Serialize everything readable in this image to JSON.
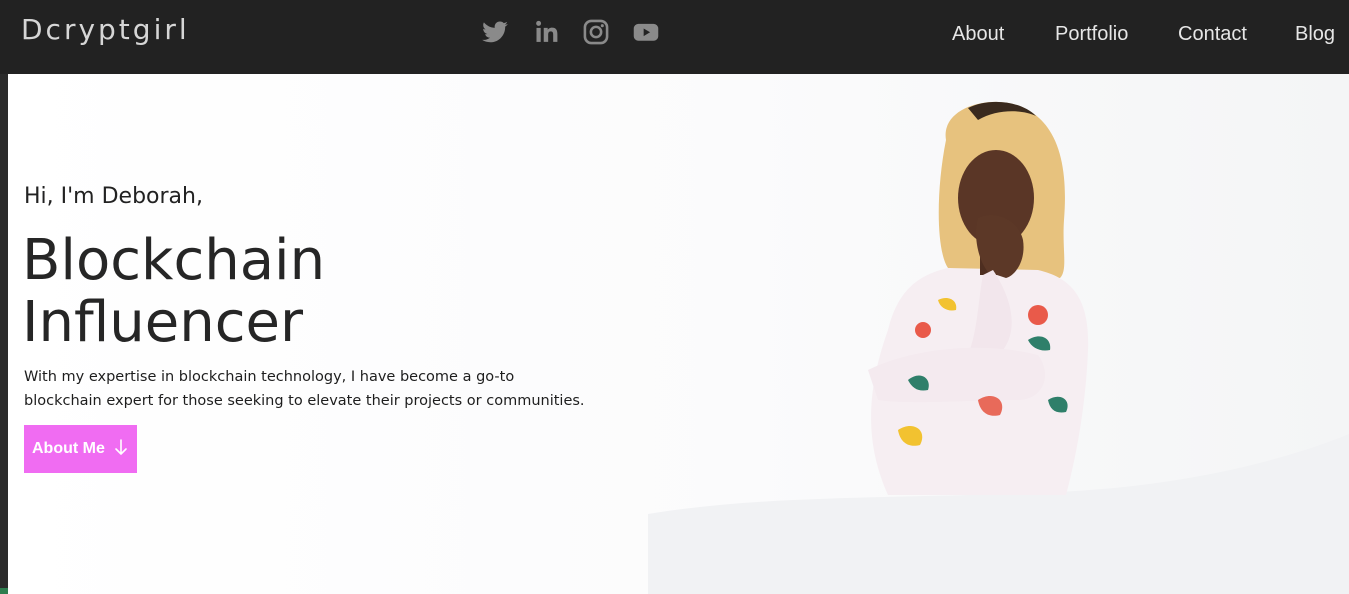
{
  "brand": "Dcryptgirl",
  "socials": [
    {
      "icon": "twitter-icon"
    },
    {
      "icon": "linkedin-icon"
    },
    {
      "icon": "instagram-icon"
    },
    {
      "icon": "youtube-icon"
    }
  ],
  "nav": {
    "about": "About",
    "portfolio": "Portfolio",
    "contact": "Contact",
    "blog": "Blog"
  },
  "hero": {
    "greeting": "Hi, I'm Deborah,",
    "headline_line1": "Blockchain",
    "headline_line2": "Influencer",
    "description": "With my expertise in blockchain technology, I have become a go-to blockchain expert for those seeking to elevate their projects or communities.",
    "button_label": "About Me",
    "button_icon": "arrow-down-icon"
  },
  "colors": {
    "navbar": "#222222",
    "accent": "#f06cf2",
    "icon_gray": "#8a8a8a"
  }
}
